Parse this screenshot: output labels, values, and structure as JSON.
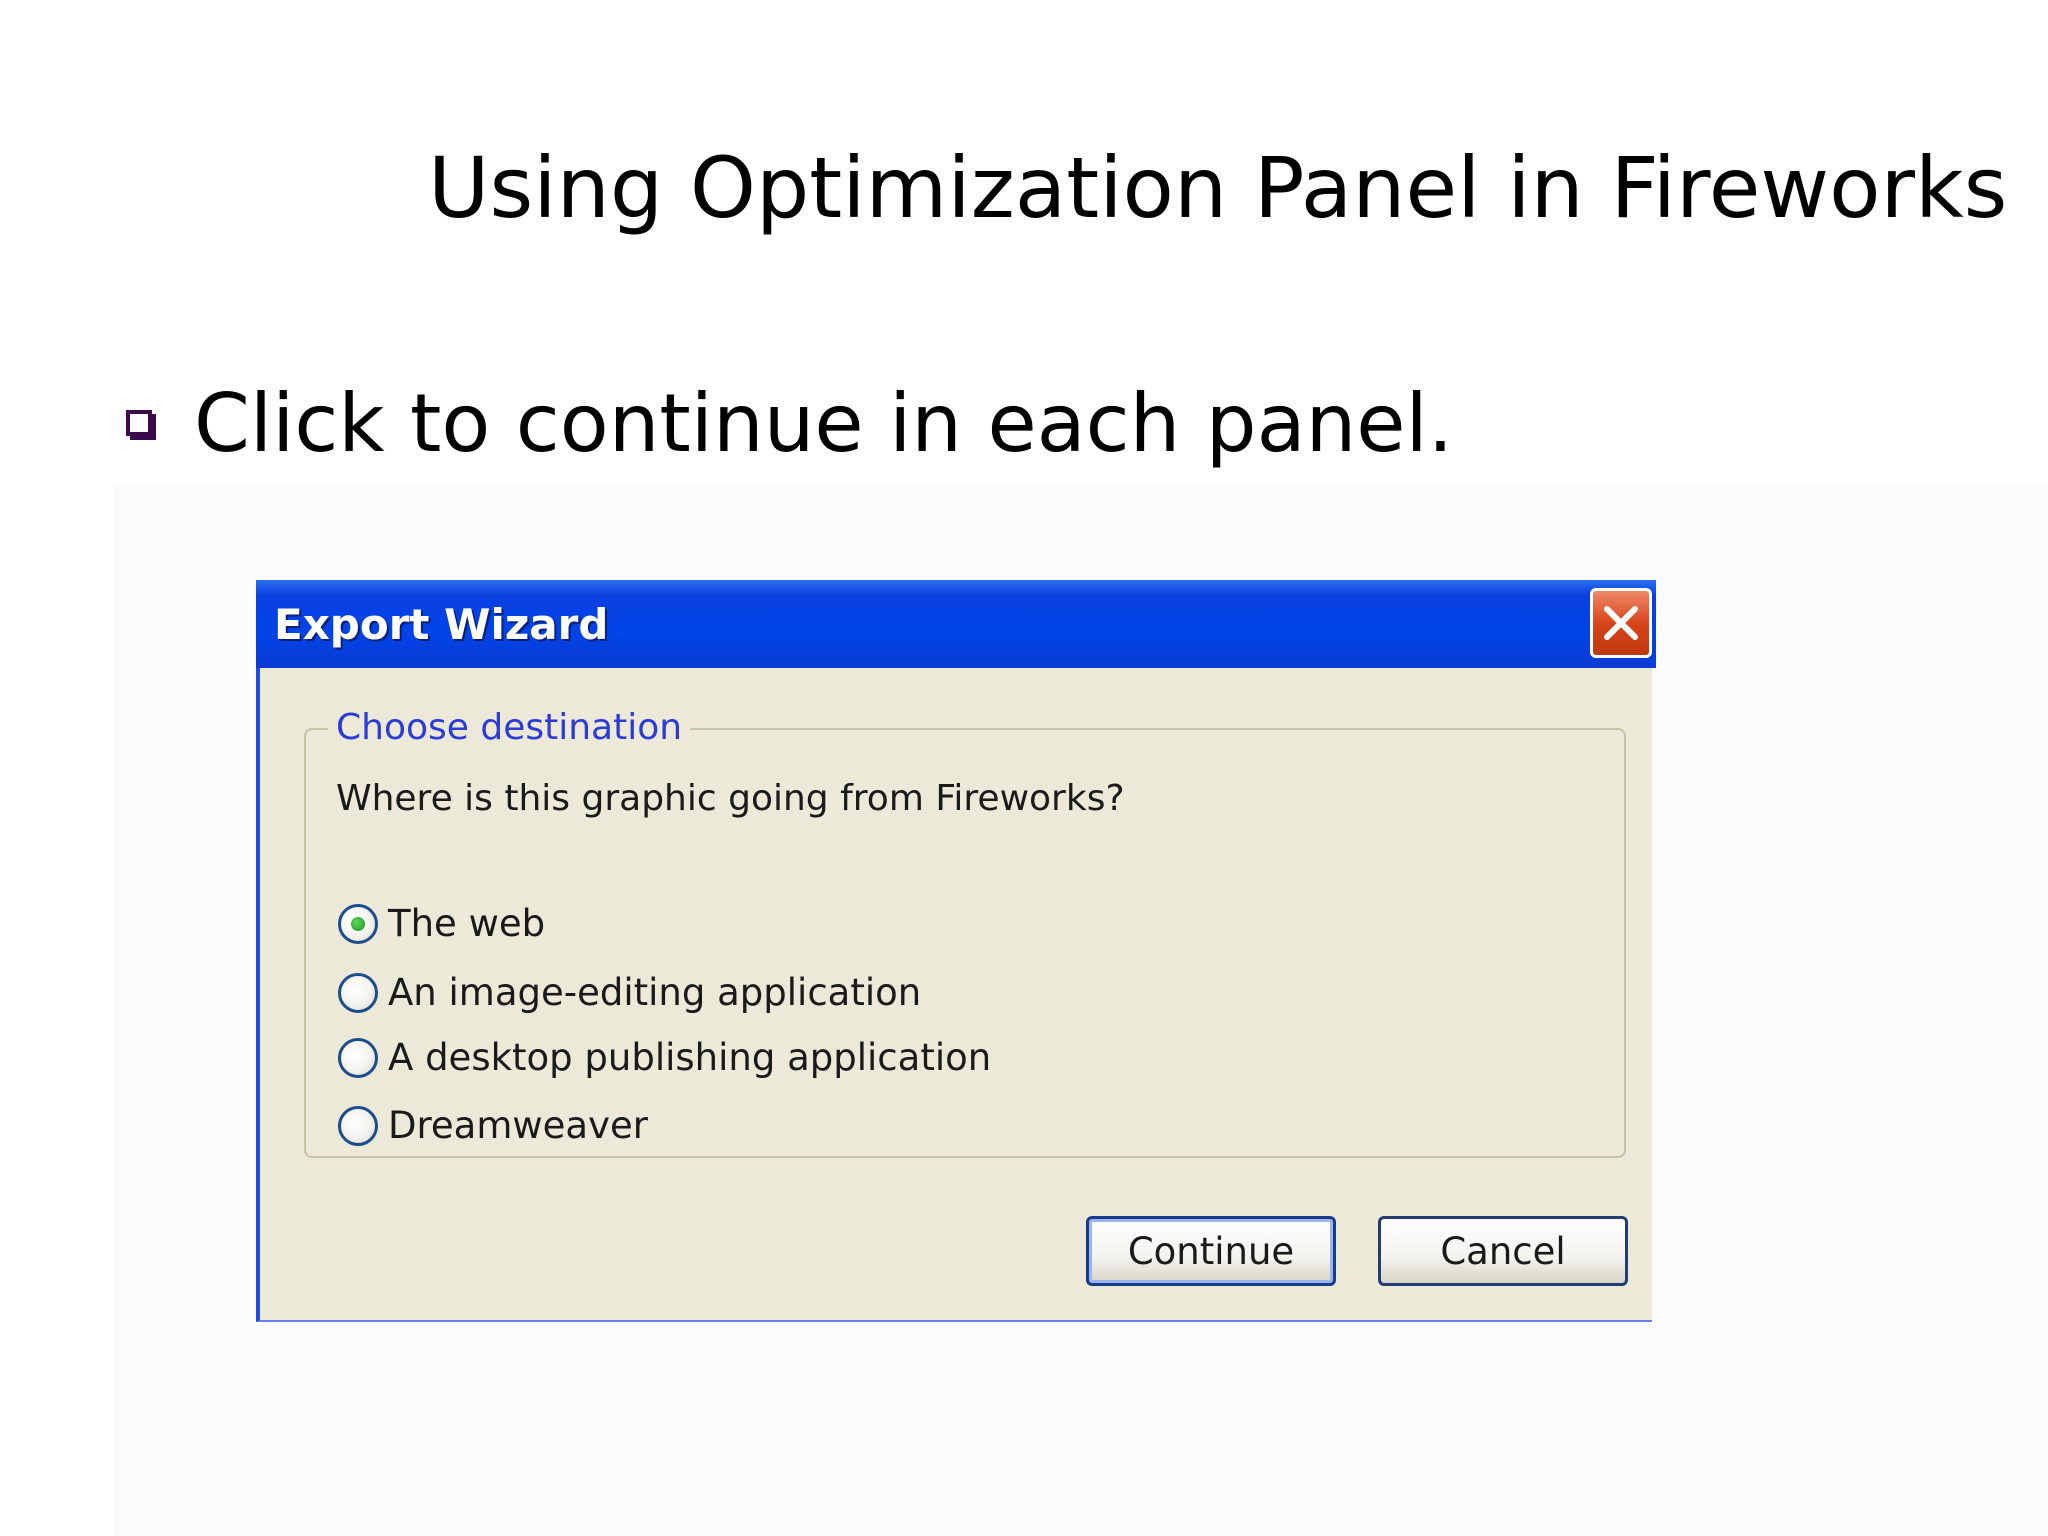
{
  "slide": {
    "title": "Using Optimization Panel in Fireworks",
    "bullet": "Click to continue in each panel."
  },
  "dialog": {
    "title": "Export Wizard",
    "close_icon": "close-icon",
    "group_label": "Choose destination",
    "prompt": "Where is this graphic going from Fireworks?",
    "options": [
      {
        "label": "The web",
        "selected": true
      },
      {
        "label": "An image-editing application",
        "selected": false
      },
      {
        "label": "A desktop publishing application",
        "selected": false
      },
      {
        "label": "Dreamweaver",
        "selected": false
      }
    ],
    "continue_label": "Continue",
    "cancel_label": "Cancel"
  },
  "colors": {
    "titlebar": "#0044e8",
    "dialog_bg": "#ece9d8",
    "group_label": "#2c3ad8",
    "close_button": "#d8441c",
    "bullet": "#3a0a4a"
  }
}
